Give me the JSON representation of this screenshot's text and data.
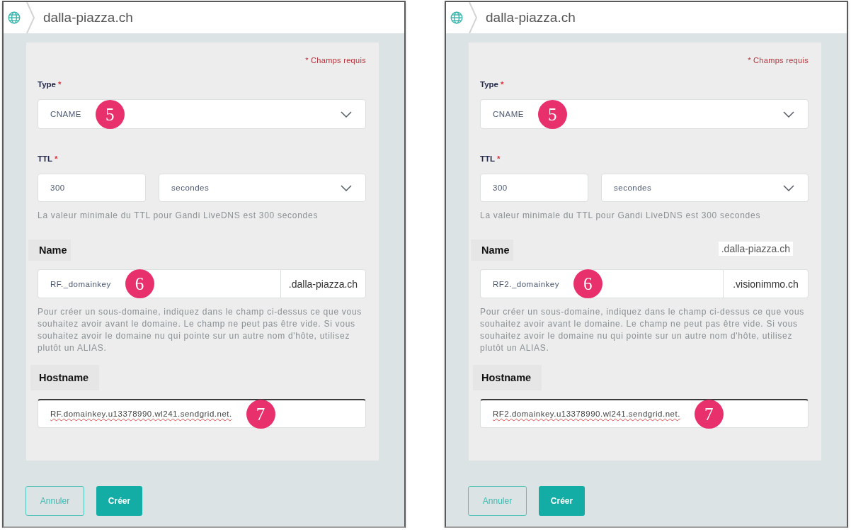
{
  "panels": [
    {
      "header": {
        "title": "dalla-piazza.ch"
      },
      "required_note": "* Champs requis",
      "type": {
        "label": "Type",
        "required_mark": "*",
        "value": "CNAME",
        "callout": "5"
      },
      "ttl": {
        "label": "TTL",
        "required_mark": "*",
        "value": "300",
        "unit": "secondes",
        "hint": "La valeur minimale du TTL pour Gandi LiveDNS est 300 secondes"
      },
      "name": {
        "label": "Name",
        "value": "RF._domainkey",
        "suffix": ".dalla-piazza.ch",
        "callout": "6",
        "help": "Pour créer un sous-domaine, indiquez dans le champ ci-dessus ce que vous souhaitez avoir avant le domaine. Le champ ne peut pas être vide. Si vous souhaitez avoir le domaine nu qui pointe sur un autre nom d'hôte, utilisez plutôt un ALIAS."
      },
      "hostname": {
        "label": "Hostname",
        "value": "RF.domainkey.u13378990.wl241.sendgrid.net.",
        "callout": "7",
        "focused": true,
        "spelling_error": true
      },
      "buttons": [
        {
          "label": "Annuler",
          "kind": "secondary"
        },
        {
          "label": "Créer",
          "kind": "primary"
        }
      ]
    },
    {
      "header": {
        "title": "dalla-piazza.ch"
      },
      "required_note": "* Champs requis",
      "type": {
        "label": "Type",
        "required_mark": "*",
        "value": "CNAME",
        "callout": "5"
      },
      "ttl": {
        "label": "TTL",
        "required_mark": "*",
        "value": "300",
        "unit": "secondes",
        "hint": "La valeur minimale du TTL pour Gandi LiveDNS est 300 secondes"
      },
      "name": {
        "label": "Name",
        "pasted_note": ".dalla-piazza.ch",
        "value": "RF2._domainkey",
        "suffix": ".visionimmo.ch",
        "callout": "6",
        "help": "Pour créer un sous-domaine, indiquez dans le champ ci-dessus ce que vous souhaitez avoir avant le domaine. Le champ ne peut pas être vide. Si vous souhaitez avoir le domaine nu qui pointe sur un autre nom d'hôte, utilisez plutôt un ALIAS."
      },
      "hostname": {
        "label": "Hostname",
        "value": "RF2.domainkey.u13378990.wl241.sendgrid.net.",
        "callout": "7",
        "focused": true,
        "spelling_error": true
      },
      "buttons": [
        {
          "label": "Annuler",
          "kind": "secondary"
        },
        {
          "label": "Créer",
          "kind": "primary"
        }
      ]
    }
  ]
}
